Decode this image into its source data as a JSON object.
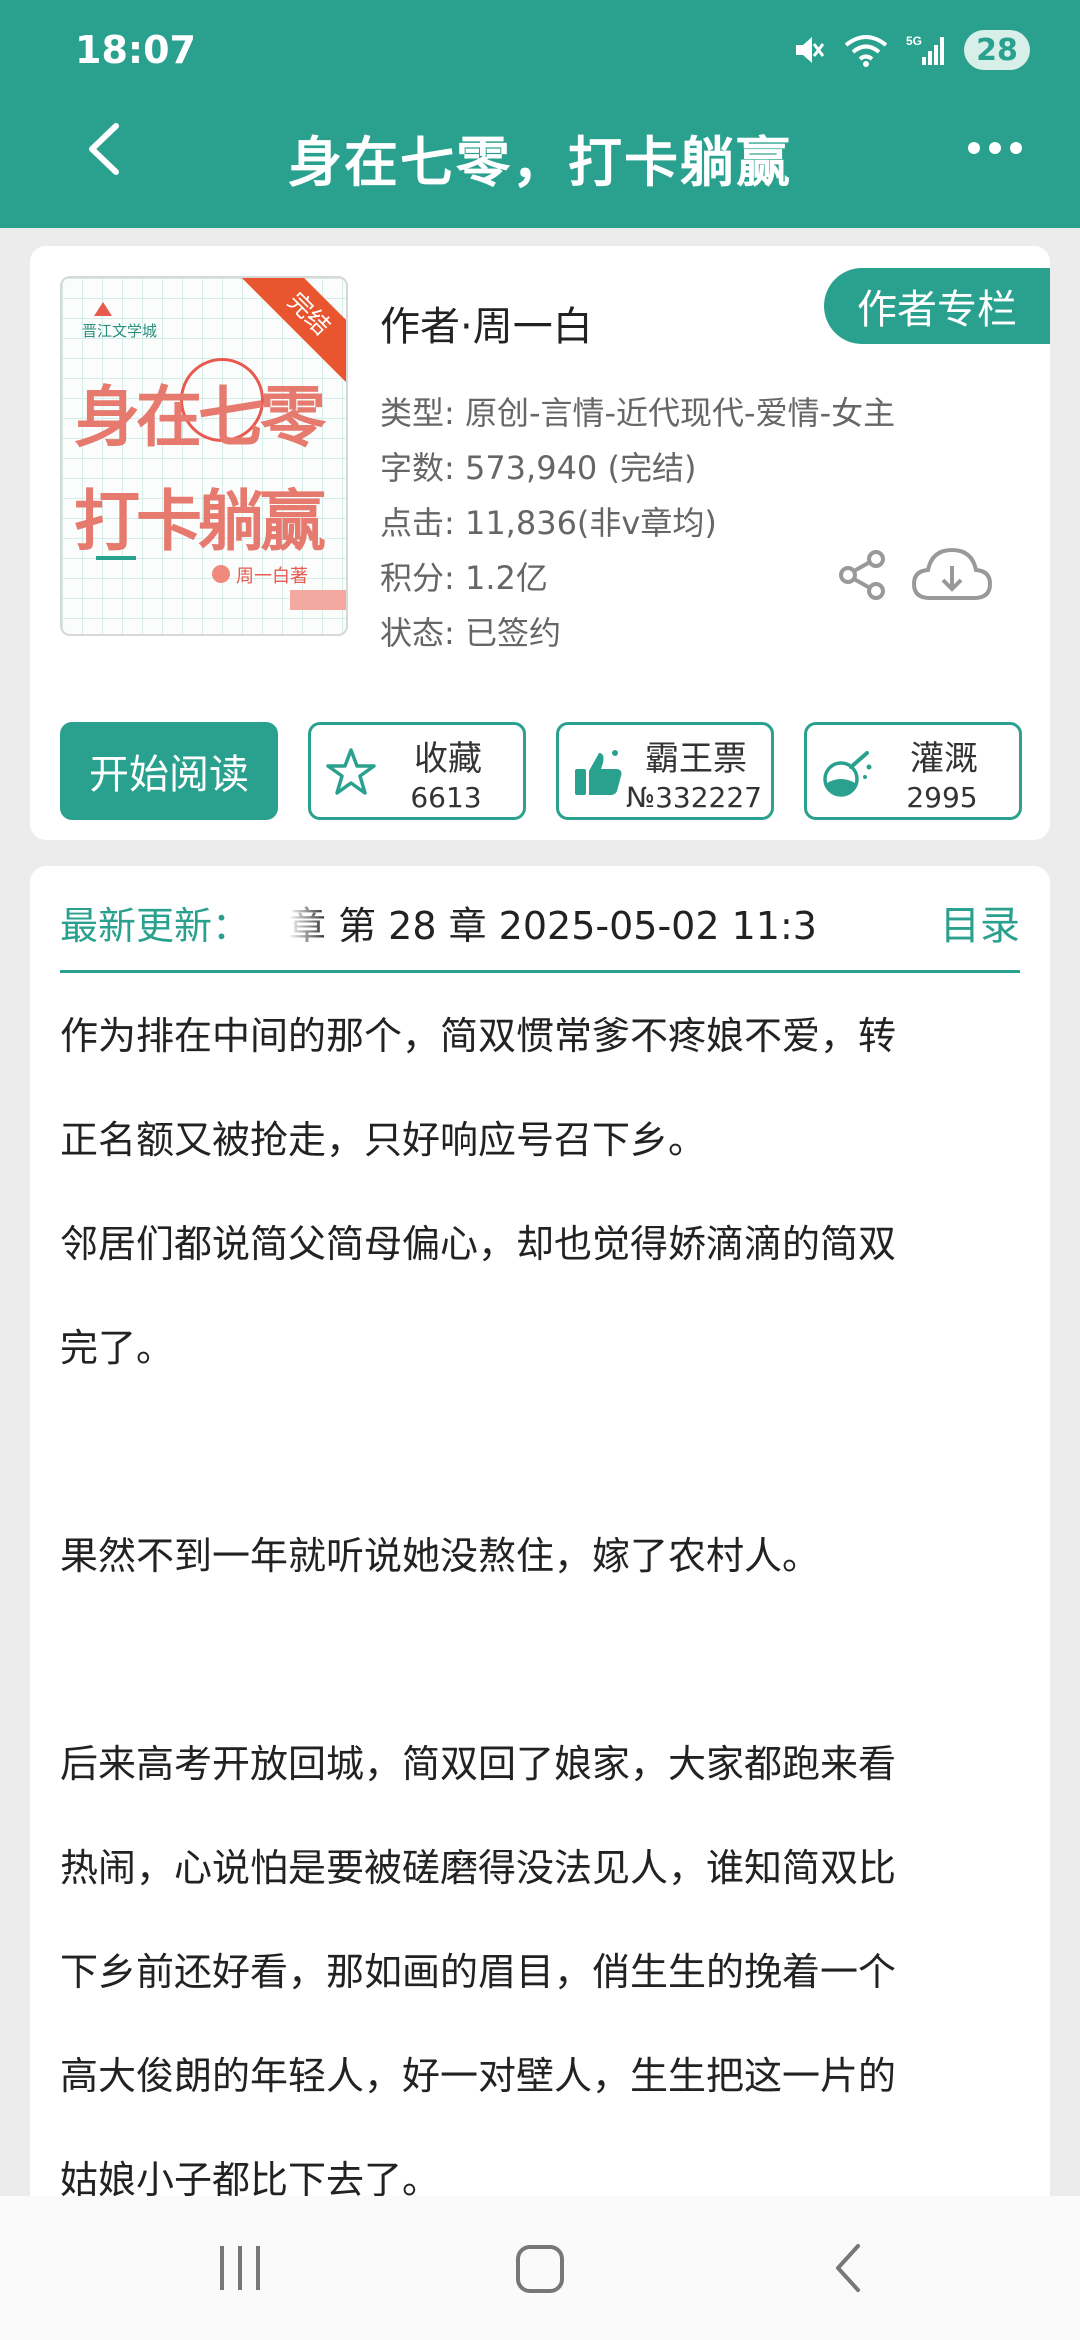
{
  "status": {
    "time": "18:07",
    "battery": "28",
    "network": "5G"
  },
  "nav": {
    "title": "身在七零，打卡躺赢",
    "back_icon": "chevron-left-icon",
    "more_icon": "more-dots-icon"
  },
  "colors": {
    "accent": "#2aa18e",
    "badge": "#e8552e"
  },
  "book": {
    "cover": {
      "publisher": "晋江文学城",
      "title_line1": "身在七零",
      "title_line2": "打卡躺赢",
      "author": "周一白著",
      "ribbon": "完结"
    },
    "author_line": "作者·周一白",
    "author_column_label": "作者专栏",
    "meta": [
      "类型: 原创-言情-近代现代-爱情-女主",
      "字数: 573,940 (完结)",
      "点击: 11,836(非v章均)",
      "积分: 1.2亿",
      "状态: 已签约"
    ]
  },
  "actions": {
    "read_label": "开始阅读",
    "favorite": {
      "label": "收藏",
      "value": "6613",
      "icon": "star-icon"
    },
    "vote": {
      "label": "霸王票",
      "value": "№332227",
      "icon": "thumbs-up-icon"
    },
    "nutrient": {
      "label": "灌溉",
      "value": "2995",
      "icon": "flask-icon"
    }
  },
  "update": {
    "label": "最新更新：",
    "text": "章  第 28 章  2025-05-02 11:3",
    "toc_label": "目录"
  },
  "synopsis": [
    "作为排在中间的那个，简双惯常爹不疼娘不爱，转",
    "正名额又被抢走，只好响应号召下乡。",
    "邻居们都说简父简母偏心，却也觉得娇滴滴的简双",
    "完了。",
    "",
    "果然不到一年就听说她没熬住，嫁了农村人。",
    "",
    "后来高考开放回城，简双回了娘家，大家都跑来看",
    "热闹，心说怕是要被磋磨得没法见人，谁知简双比",
    "下乡前还好看，那如画的眉目，俏生生的挽着一个",
    "高大俊朗的年轻人，好一对壁人，生生把这一片的",
    "姑娘小子都比下去了。"
  ]
}
